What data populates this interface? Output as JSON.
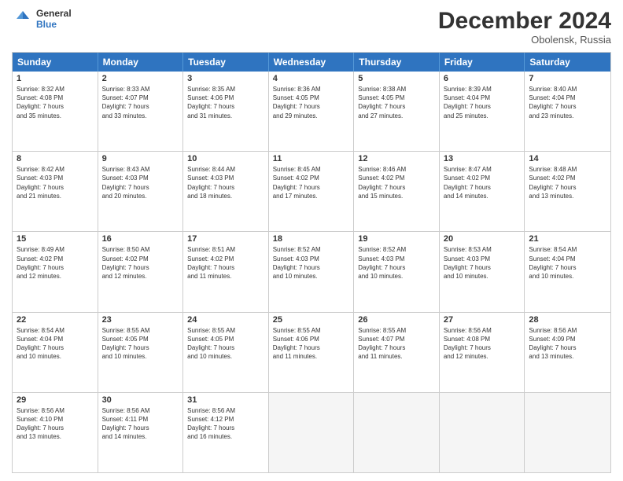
{
  "header": {
    "logo_line1": "General",
    "logo_line2": "Blue",
    "month_title": "December 2024",
    "location": "Obolensk, Russia"
  },
  "days_of_week": [
    "Sunday",
    "Monday",
    "Tuesday",
    "Wednesday",
    "Thursday",
    "Friday",
    "Saturday"
  ],
  "weeks": [
    [
      {
        "day": "1",
        "lines": [
          "Sunrise: 8:32 AM",
          "Sunset: 4:08 PM",
          "Daylight: 7 hours",
          "and 35 minutes."
        ]
      },
      {
        "day": "2",
        "lines": [
          "Sunrise: 8:33 AM",
          "Sunset: 4:07 PM",
          "Daylight: 7 hours",
          "and 33 minutes."
        ]
      },
      {
        "day": "3",
        "lines": [
          "Sunrise: 8:35 AM",
          "Sunset: 4:06 PM",
          "Daylight: 7 hours",
          "and 31 minutes."
        ]
      },
      {
        "day": "4",
        "lines": [
          "Sunrise: 8:36 AM",
          "Sunset: 4:05 PM",
          "Daylight: 7 hours",
          "and 29 minutes."
        ]
      },
      {
        "day": "5",
        "lines": [
          "Sunrise: 8:38 AM",
          "Sunset: 4:05 PM",
          "Daylight: 7 hours",
          "and 27 minutes."
        ]
      },
      {
        "day": "6",
        "lines": [
          "Sunrise: 8:39 AM",
          "Sunset: 4:04 PM",
          "Daylight: 7 hours",
          "and 25 minutes."
        ]
      },
      {
        "day": "7",
        "lines": [
          "Sunrise: 8:40 AM",
          "Sunset: 4:04 PM",
          "Daylight: 7 hours",
          "and 23 minutes."
        ]
      }
    ],
    [
      {
        "day": "8",
        "lines": [
          "Sunrise: 8:42 AM",
          "Sunset: 4:03 PM",
          "Daylight: 7 hours",
          "and 21 minutes."
        ]
      },
      {
        "day": "9",
        "lines": [
          "Sunrise: 8:43 AM",
          "Sunset: 4:03 PM",
          "Daylight: 7 hours",
          "and 20 minutes."
        ]
      },
      {
        "day": "10",
        "lines": [
          "Sunrise: 8:44 AM",
          "Sunset: 4:03 PM",
          "Daylight: 7 hours",
          "and 18 minutes."
        ]
      },
      {
        "day": "11",
        "lines": [
          "Sunrise: 8:45 AM",
          "Sunset: 4:02 PM",
          "Daylight: 7 hours",
          "and 17 minutes."
        ]
      },
      {
        "day": "12",
        "lines": [
          "Sunrise: 8:46 AM",
          "Sunset: 4:02 PM",
          "Daylight: 7 hours",
          "and 15 minutes."
        ]
      },
      {
        "day": "13",
        "lines": [
          "Sunrise: 8:47 AM",
          "Sunset: 4:02 PM",
          "Daylight: 7 hours",
          "and 14 minutes."
        ]
      },
      {
        "day": "14",
        "lines": [
          "Sunrise: 8:48 AM",
          "Sunset: 4:02 PM",
          "Daylight: 7 hours",
          "and 13 minutes."
        ]
      }
    ],
    [
      {
        "day": "15",
        "lines": [
          "Sunrise: 8:49 AM",
          "Sunset: 4:02 PM",
          "Daylight: 7 hours",
          "and 12 minutes."
        ]
      },
      {
        "day": "16",
        "lines": [
          "Sunrise: 8:50 AM",
          "Sunset: 4:02 PM",
          "Daylight: 7 hours",
          "and 12 minutes."
        ]
      },
      {
        "day": "17",
        "lines": [
          "Sunrise: 8:51 AM",
          "Sunset: 4:02 PM",
          "Daylight: 7 hours",
          "and 11 minutes."
        ]
      },
      {
        "day": "18",
        "lines": [
          "Sunrise: 8:52 AM",
          "Sunset: 4:03 PM",
          "Daylight: 7 hours",
          "and 10 minutes."
        ]
      },
      {
        "day": "19",
        "lines": [
          "Sunrise: 8:52 AM",
          "Sunset: 4:03 PM",
          "Daylight: 7 hours",
          "and 10 minutes."
        ]
      },
      {
        "day": "20",
        "lines": [
          "Sunrise: 8:53 AM",
          "Sunset: 4:03 PM",
          "Daylight: 7 hours",
          "and 10 minutes."
        ]
      },
      {
        "day": "21",
        "lines": [
          "Sunrise: 8:54 AM",
          "Sunset: 4:04 PM",
          "Daylight: 7 hours",
          "and 10 minutes."
        ]
      }
    ],
    [
      {
        "day": "22",
        "lines": [
          "Sunrise: 8:54 AM",
          "Sunset: 4:04 PM",
          "Daylight: 7 hours",
          "and 10 minutes."
        ]
      },
      {
        "day": "23",
        "lines": [
          "Sunrise: 8:55 AM",
          "Sunset: 4:05 PM",
          "Daylight: 7 hours",
          "and 10 minutes."
        ]
      },
      {
        "day": "24",
        "lines": [
          "Sunrise: 8:55 AM",
          "Sunset: 4:05 PM",
          "Daylight: 7 hours",
          "and 10 minutes."
        ]
      },
      {
        "day": "25",
        "lines": [
          "Sunrise: 8:55 AM",
          "Sunset: 4:06 PM",
          "Daylight: 7 hours",
          "and 11 minutes."
        ]
      },
      {
        "day": "26",
        "lines": [
          "Sunrise: 8:55 AM",
          "Sunset: 4:07 PM",
          "Daylight: 7 hours",
          "and 11 minutes."
        ]
      },
      {
        "day": "27",
        "lines": [
          "Sunrise: 8:56 AM",
          "Sunset: 4:08 PM",
          "Daylight: 7 hours",
          "and 12 minutes."
        ]
      },
      {
        "day": "28",
        "lines": [
          "Sunrise: 8:56 AM",
          "Sunset: 4:09 PM",
          "Daylight: 7 hours",
          "and 13 minutes."
        ]
      }
    ],
    [
      {
        "day": "29",
        "lines": [
          "Sunrise: 8:56 AM",
          "Sunset: 4:10 PM",
          "Daylight: 7 hours",
          "and 13 minutes."
        ]
      },
      {
        "day": "30",
        "lines": [
          "Sunrise: 8:56 AM",
          "Sunset: 4:11 PM",
          "Daylight: 7 hours",
          "and 14 minutes."
        ]
      },
      {
        "day": "31",
        "lines": [
          "Sunrise: 8:56 AM",
          "Sunset: 4:12 PM",
          "Daylight: 7 hours",
          "and 16 minutes."
        ]
      },
      {
        "day": "",
        "lines": []
      },
      {
        "day": "",
        "lines": []
      },
      {
        "day": "",
        "lines": []
      },
      {
        "day": "",
        "lines": []
      }
    ]
  ]
}
